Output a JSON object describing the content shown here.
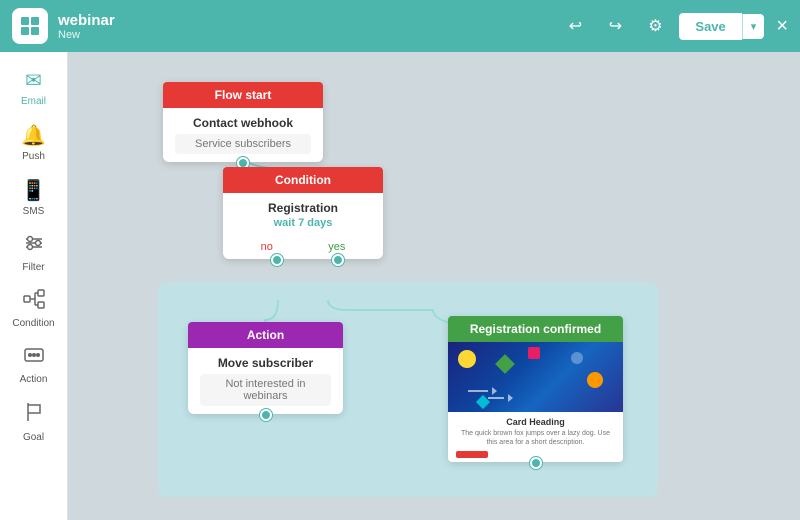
{
  "app": {
    "name": "webinar",
    "status": "New"
  },
  "header": {
    "save_label": "Save",
    "close_label": "×",
    "undo_icon": "↩",
    "redo_icon": "↪",
    "settings_icon": "⚙"
  },
  "sidebar": {
    "items": [
      {
        "id": "email",
        "label": "Email",
        "icon": "✉"
      },
      {
        "id": "push",
        "label": "Push",
        "icon": "🔔"
      },
      {
        "id": "sms",
        "label": "SMS",
        "icon": "📱"
      },
      {
        "id": "filter",
        "label": "Filter",
        "icon": "⛶"
      },
      {
        "id": "condition",
        "label": "Condition",
        "icon": "⚙"
      },
      {
        "id": "action",
        "label": "Action",
        "icon": "🤖"
      },
      {
        "id": "goal",
        "label": "Goal",
        "icon": "🚩"
      }
    ]
  },
  "canvas": {
    "nodes": {
      "flow_start": {
        "header": "Flow start",
        "title": "Contact webhook",
        "subtitle": "Service subscribers"
      },
      "condition": {
        "header": "Condition",
        "title": "Registration",
        "wait": "wait",
        "wait_value": "7",
        "wait_unit": "days",
        "label_no": "no",
        "label_yes": "yes"
      },
      "action": {
        "header": "Action",
        "title": "Move subscriber",
        "subtitle": "Not interested in webinars"
      },
      "reg_confirmed": {
        "header": "Registration confirmed",
        "card_heading": "Card Heading",
        "card_body": "The quick brown fox jumps over a lazy dog. Use this area for a short description."
      }
    }
  }
}
